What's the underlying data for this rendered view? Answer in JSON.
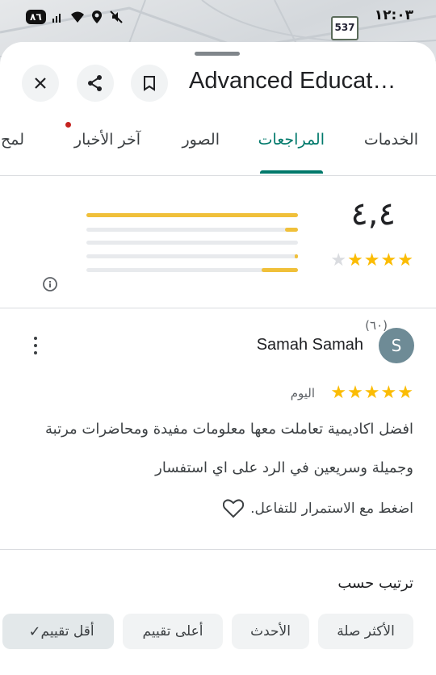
{
  "status_bar": {
    "time": "١٢:٠٣",
    "battery": "٨٦",
    "route_number": "537"
  },
  "header": {
    "title": "Advanced Educat…",
    "icons": [
      "close-icon",
      "share-icon",
      "bookmark-icon"
    ]
  },
  "tabs": [
    {
      "label": "الخدمات",
      "active": false
    },
    {
      "label": "المراجعات",
      "active": true
    },
    {
      "label": "الصور",
      "active": false
    },
    {
      "label": "آخر الأخبار",
      "active": false,
      "has_notification_dot": true
    },
    {
      "label": "لمح",
      "active": false
    }
  ],
  "rating_summary": {
    "average": "٤,٤",
    "stars": 4.4,
    "review_count": "(٦٠)",
    "distribution": [
      {
        "stars": 5,
        "fraction": 1.0
      },
      {
        "stars": 4,
        "fraction": 0.06
      },
      {
        "stars": 3,
        "fraction": 0.0
      },
      {
        "stars": 2,
        "fraction": 0.01
      },
      {
        "stars": 1,
        "fraction": 0.17
      }
    ]
  },
  "review": {
    "avatar_letter": "S",
    "author": "Samah Samah",
    "stars": 5,
    "date": "اليوم",
    "text": "افضل اكاديمية تعاملت معها معلومات مفيدة ومحاضرات مرتبة وجميلة وسريعين في الرد على اي استفسار",
    "like_prompt": "اضغط مع الاستمرار للتفاعل."
  },
  "sort": {
    "title": "ترتيب حسب",
    "options": [
      {
        "label": "الأكثر صلة",
        "selected": false
      },
      {
        "label": "الأحدث",
        "selected": false
      },
      {
        "label": "أعلى تقييم",
        "selected": false
      },
      {
        "label": "أقل تقييم",
        "selected": true
      }
    ]
  },
  "colors": {
    "accent": "#00796b",
    "star": "#fbbc04",
    "bar": "#f0c03a",
    "notification_dot": "#c5221f"
  }
}
